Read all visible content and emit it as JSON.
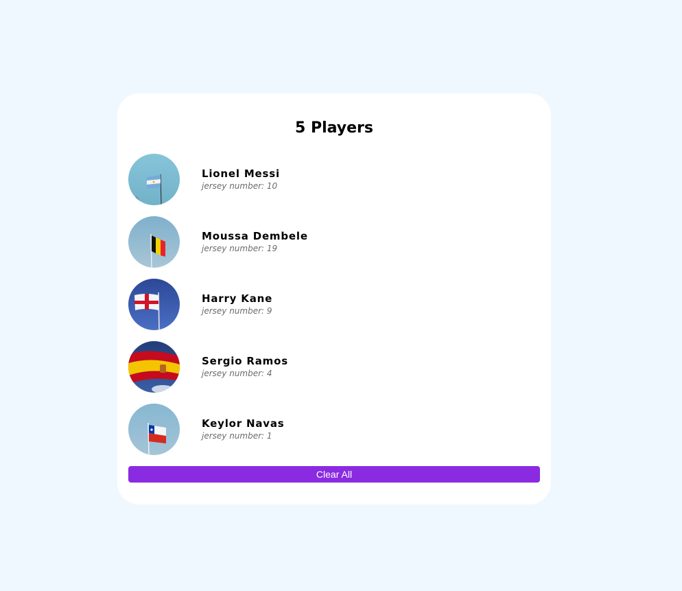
{
  "header": {
    "title": "5 Players"
  },
  "players": [
    {
      "name": "Lionel Messi",
      "jersey_label": "jersey number: 10",
      "flag_icon": "argentina-flag-icon",
      "sky_color": "#7fbfd6"
    },
    {
      "name": "Moussa Dembele",
      "jersey_label": "jersey number: 19",
      "flag_icon": "belgium-flag-icon",
      "sky_color": "#8db5cc"
    },
    {
      "name": "Harry Kane",
      "jersey_label": "jersey number: 9",
      "flag_icon": "england-flag-icon",
      "sky_color": "#3857a8"
    },
    {
      "name": "Sergio Ramos",
      "jersey_label": "jersey number: 4",
      "flag_icon": "spain-flag-icon",
      "sky_color": "#2d4c8c"
    },
    {
      "name": "Keylor Navas",
      "jersey_label": "jersey number: 1",
      "flag_icon": "chile-flag-icon",
      "sky_color": "#8cb8d0"
    }
  ],
  "actions": {
    "clear_label": "Clear All"
  },
  "colors": {
    "page_background": "#f0f8ff",
    "card_background": "#ffffff",
    "button_background": "#8a2be2",
    "button_text": "#ffffff",
    "jersey_text": "#6b6b6b"
  }
}
